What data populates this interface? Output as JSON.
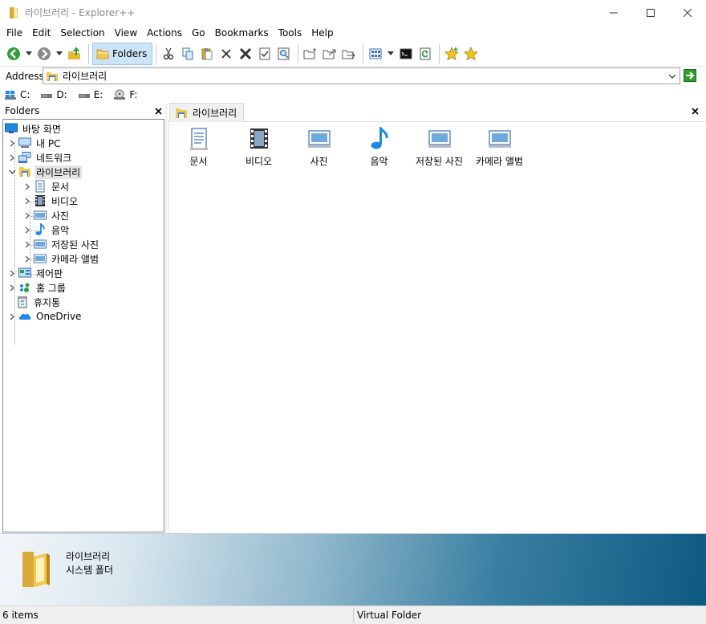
{
  "window": {
    "title": "라이브러리",
    "title_suffix": " - Explorer++"
  },
  "menu": [
    "File",
    "Edit",
    "Selection",
    "View",
    "Actions",
    "Go",
    "Bookmarks",
    "Tools",
    "Help"
  ],
  "toolbar": {
    "folders_label": "Folders"
  },
  "address": {
    "label": "Address",
    "value": "라이브러리"
  },
  "drives": [
    "C:",
    "D:",
    "E:",
    "F:"
  ],
  "folders_panel": {
    "title": "Folders",
    "tree": [
      {
        "label": "바탕 화면",
        "icon": "desktop-icon"
      },
      {
        "label": "내 PC",
        "icon": "computer-icon"
      },
      {
        "label": "네트워크",
        "icon": "network-icon"
      },
      {
        "label": "라이브러리",
        "icon": "library-icon",
        "selected": true
      },
      {
        "label": "문서",
        "icon": "documents-icon"
      },
      {
        "label": "비디오",
        "icon": "videos-icon"
      },
      {
        "label": "사진",
        "icon": "pictures-icon"
      },
      {
        "label": "음악",
        "icon": "music-icon"
      },
      {
        "label": "저장된 사진",
        "icon": "pictures-icon"
      },
      {
        "label": "카메라 앨범",
        "icon": "pictures-icon"
      },
      {
        "label": "제어판",
        "icon": "control-panel-icon"
      },
      {
        "label": "홈 그룹",
        "icon": "homegroup-icon"
      },
      {
        "label": "휴지통",
        "icon": "recycle-bin-icon"
      },
      {
        "label": "OneDrive",
        "icon": "onedrive-icon"
      }
    ]
  },
  "tab": {
    "label": "라이브러리"
  },
  "items": [
    {
      "label": "문서",
      "icon": "documents-icon"
    },
    {
      "label": "비디오",
      "icon": "videos-icon"
    },
    {
      "label": "사진",
      "icon": "pictures-icon"
    },
    {
      "label": "음악",
      "icon": "music-icon"
    },
    {
      "label": "저장된 사진",
      "icon": "pictures-icon"
    },
    {
      "label": "카메라 앨범",
      "icon": "pictures-icon"
    }
  ],
  "info_pane": {
    "name": "라이브러리",
    "type": "시스템 폴더"
  },
  "status": {
    "count": "6 items",
    "type": "Virtual Folder"
  }
}
